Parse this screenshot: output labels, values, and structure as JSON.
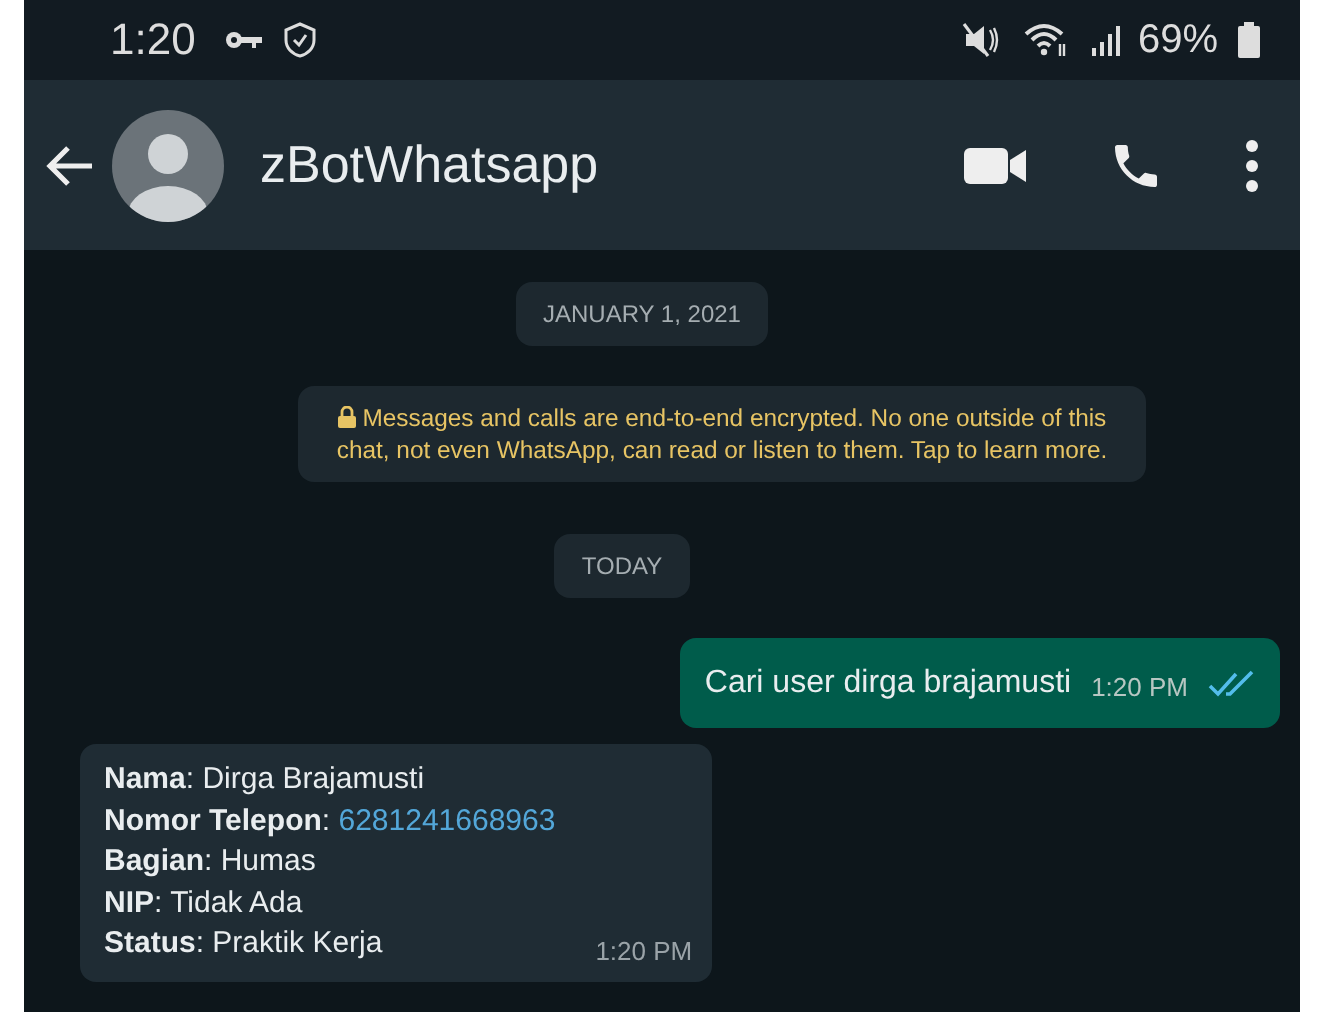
{
  "status_bar": {
    "time": "1:20",
    "battery": "69%"
  },
  "header": {
    "title": "zBotWhatsapp"
  },
  "date_chip": "JANUARY 1, 2021",
  "encryption_notice": "Messages and calls are end-to-end encrypted. No one outside of this chat, not even WhatsApp, can read or listen to them. Tap to learn more.",
  "today_chip": "TODAY",
  "messages": [
    {
      "kind": "sent",
      "text": "Cari user dirga brajamusti",
      "time": "1:20 PM",
      "read": true
    },
    {
      "kind": "received",
      "lines": [
        {
          "text": "**Nama**: Dirga Brajamusti"
        },
        {
          "text": "**Nomor Telepon**: ",
          "link": "6281241668963"
        },
        {
          "text": "**Bagian**: Humas"
        },
        {
          "text": "**NIP**: Tidak Ada"
        },
        {
          "text": "**Status**: Praktik Kerja"
        }
      ],
      "time": "1:20 PM"
    }
  ]
}
